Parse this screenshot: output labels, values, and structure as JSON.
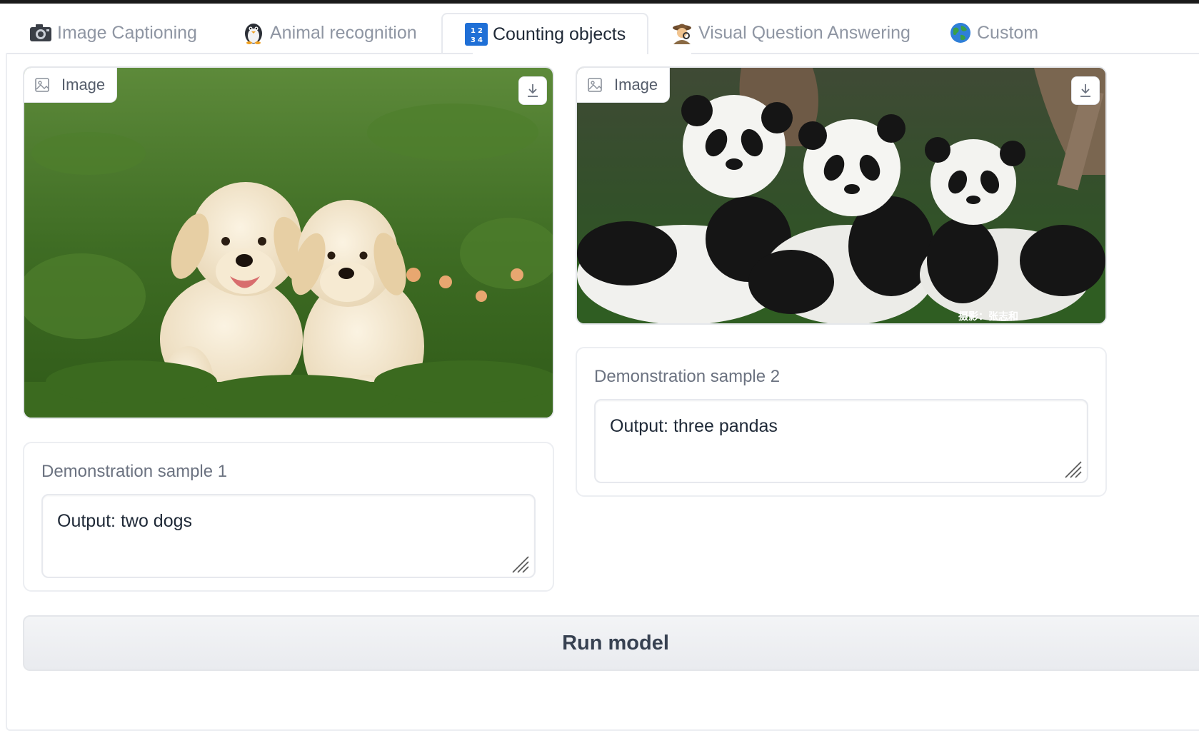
{
  "tabs": [
    {
      "label": "Image Captioning",
      "icon": "camera-icon",
      "active": false
    },
    {
      "label": "Animal recognition",
      "icon": "penguin-icon",
      "active": false
    },
    {
      "label": "Counting objects",
      "icon": "input-numbers-icon",
      "active": true
    },
    {
      "label": "Visual Question Answering",
      "icon": "detective-icon",
      "active": false
    },
    {
      "label": "Custom",
      "icon": "globe-icon",
      "active": false
    }
  ],
  "samples": [
    {
      "image_label": "Image",
      "image_subject": "two puppies on grass",
      "card_label": "Demonstration sample 1",
      "output_text": "Output: two dogs"
    },
    {
      "image_label": "Image",
      "image_subject": "three pandas",
      "watermark": "摄影：张志和",
      "card_label": "Demonstration sample 2",
      "output_text": "Output: three pandas"
    }
  ],
  "run_button_label": "Run model",
  "colors": {
    "accent_tab_icon": "#1f6fd6",
    "button_bg": "#eceef1",
    "border": "#e7e9ee"
  }
}
